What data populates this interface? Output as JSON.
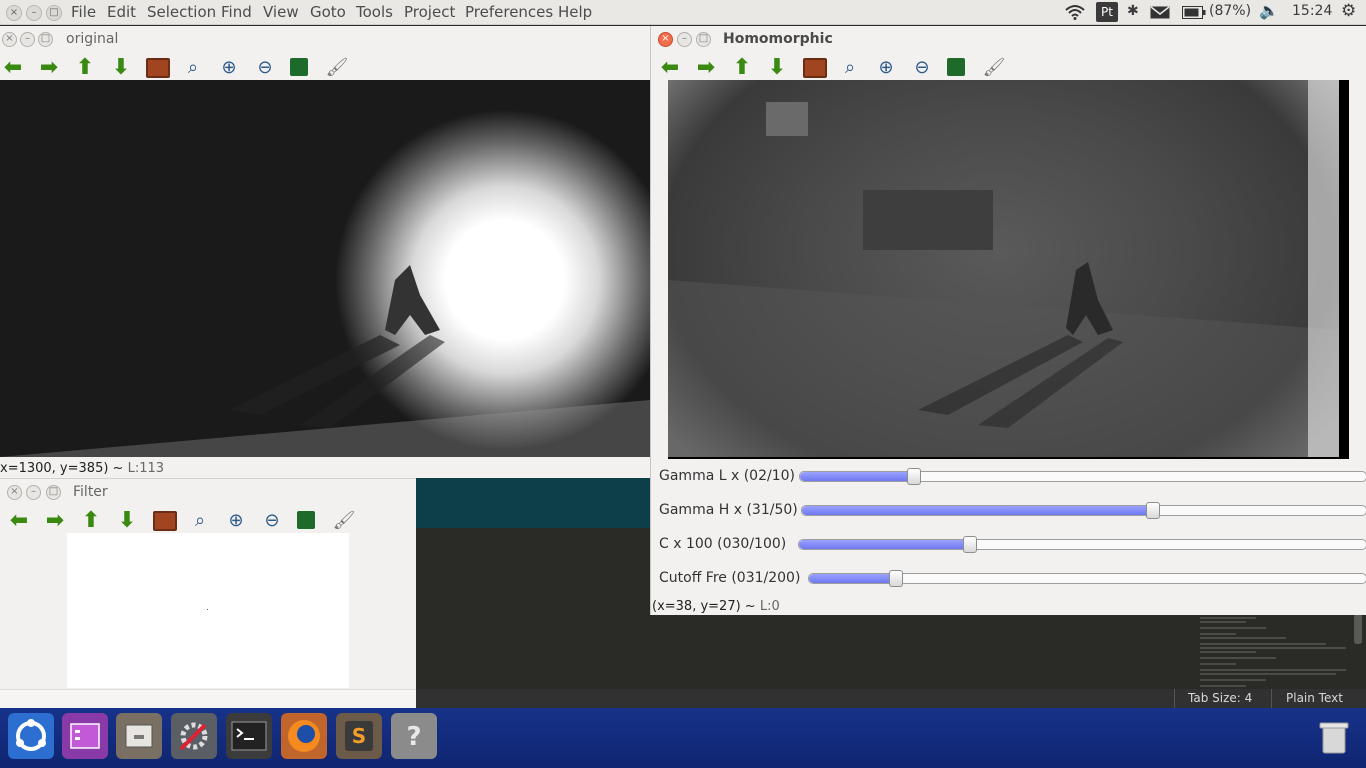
{
  "menubar": {
    "items": [
      "File",
      "Edit",
      "Selection",
      "Find",
      "View",
      "Goto",
      "Tools",
      "Project",
      "Preferences",
      "Help"
    ]
  },
  "tray": {
    "keyboard": "Pt",
    "battery": "(87%)",
    "time": "15:24"
  },
  "windows": {
    "original": {
      "title": "original",
      "status_coords": "x=1300, y=385) ~",
      "status_value": "L:113"
    },
    "homomorphic": {
      "title": "Homomorphic",
      "status_coords": "(x=38, y=27) ~",
      "status_value": "L:0",
      "sliders": [
        {
          "label": "Gamma L x  (02/10)",
          "value": 0.2
        },
        {
          "label": "Gamma H x  (31/50)",
          "value": 0.62
        },
        {
          "label": "C x 100    (030/100)",
          "value": 0.3
        },
        {
          "label": "Cutoff Fre (031/200)",
          "value": 0.155
        }
      ]
    },
    "filter": {
      "title": "Filter"
    }
  },
  "editor_status": {
    "tab_size": "Tab Size: 4",
    "syntax": "Plain Text"
  },
  "dock": {
    "items": [
      "ubuntu-dash-icon",
      "software-center-icon",
      "files-icon",
      "system-settings-icon",
      "terminal-icon",
      "firefox-icon",
      "sublime-text-icon",
      "unknown-app-icon",
      "trash-icon"
    ]
  },
  "colors": {
    "panel": "#e9e8e5",
    "dock": "#17328a",
    "slider_fill": "#7c84f4",
    "toolbar_arrow": "#3a8a12"
  }
}
